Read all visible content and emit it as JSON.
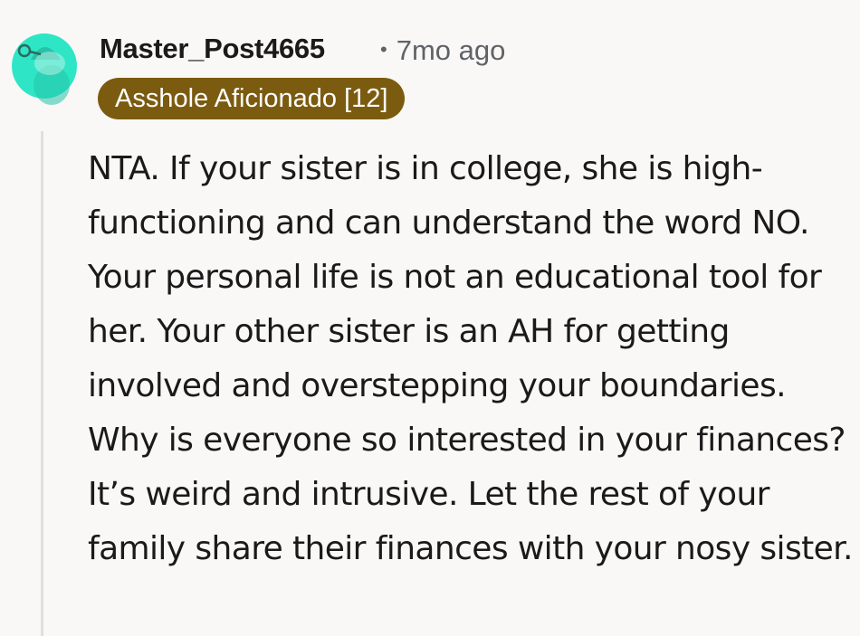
{
  "comment": {
    "author": "Master_Post4665",
    "separator": "•",
    "timestamp": "7mo ago",
    "flair": "Asshole Aficionado [12]",
    "avatar_icon": "reddit-snoo-avatar-icon",
    "body": "NTA. If your sister is in college, she is high-functioning and can understand the word NO. Your personal life is not an educational tool for her. Your other sister is an AH for getting involved and overstepping your boundaries. Why is everyone so interested in your finances? It’s weird and intrusive. Let the rest of your family share their finances with your nosy sister."
  },
  "colors": {
    "background": "#f9f8f6",
    "avatar": "#2ee6c6",
    "flair_background": "#7b5b10",
    "flair_text": "#ffffff",
    "meta_text": "#5f6368",
    "thread_line": "#e0dfdc"
  }
}
